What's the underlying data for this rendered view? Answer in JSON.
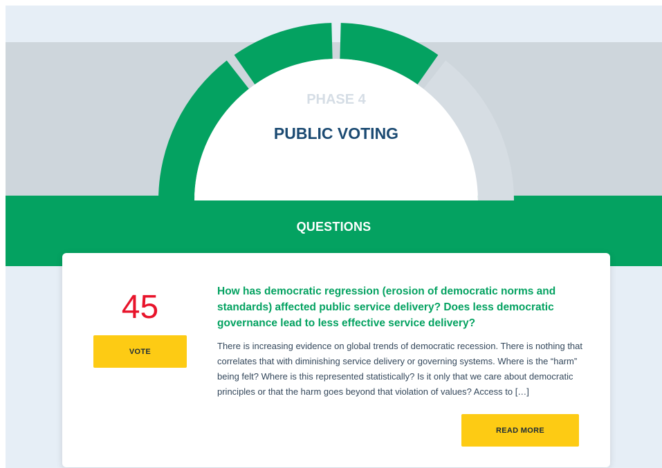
{
  "phase": {
    "number_label": "PHASE 4",
    "name": "PUBLIC VOTING",
    "segments_completed": 3,
    "segments_total": 4
  },
  "section": {
    "title": "QUESTIONS"
  },
  "question": {
    "votes": "45",
    "vote_label": "VOTE",
    "title": "How has democratic regression (erosion of democratic norms and standards) affected public service delivery? Does less democratic governance lead to less effective service delivery?",
    "excerpt": "There is increasing evidence on global trends of democratic recession. There is nothing that correlates that with diminishing service delivery or governing systems. Where is the “harm” being felt? Where is this represented statistically? Is it only that we care about democratic principles or that the harm goes beyond that violation of values? Access to […]",
    "read_more_label": "READ MORE"
  },
  "colors": {
    "brand_green": "#04a261",
    "title_navy": "#1b4a72",
    "vote_red": "#e8142b",
    "button_yellow": "#fdcb14",
    "inactive_gray": "#d6dde3"
  }
}
